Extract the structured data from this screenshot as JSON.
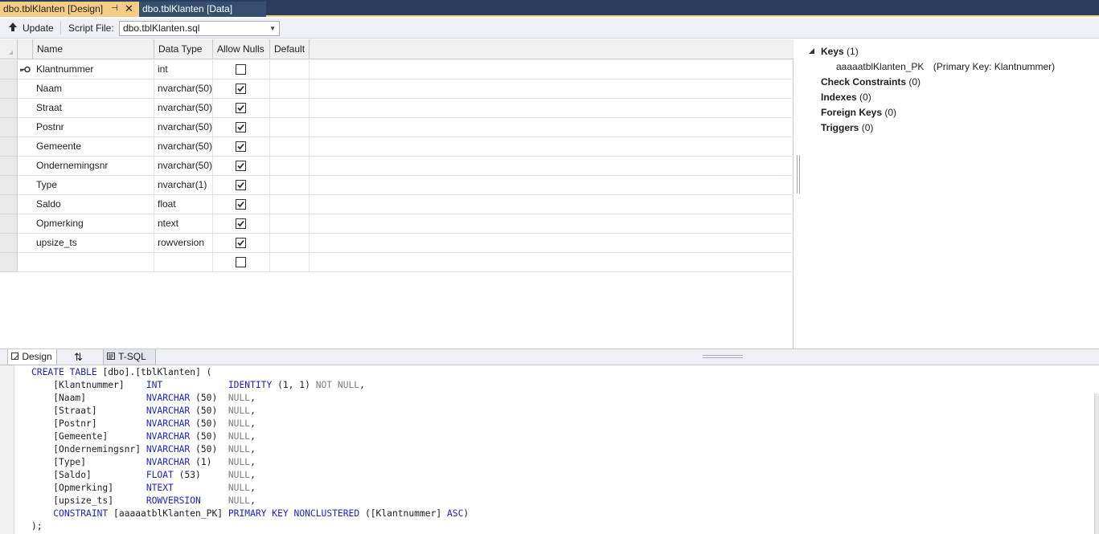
{
  "tabs": {
    "active_label": "dbo.tblKlanten [Design]",
    "inactive_label": "dbo.tblKlanten [Data]"
  },
  "toolbar": {
    "update_label": "Update",
    "script_file_label": "Script File:",
    "script_file_value": "dbo.tblKlanten.sql"
  },
  "grid": {
    "headers": [
      "Name",
      "Data Type",
      "Allow Nulls",
      "Default"
    ],
    "rows": [
      {
        "name": "Klantnummer",
        "type": "int",
        "allow_nulls": false,
        "primary_key": true
      },
      {
        "name": "Naam",
        "type": "nvarchar(50)",
        "allow_nulls": true
      },
      {
        "name": "Straat",
        "type": "nvarchar(50)",
        "allow_nulls": true
      },
      {
        "name": "Postnr",
        "type": "nvarchar(50)",
        "allow_nulls": true
      },
      {
        "name": "Gemeente",
        "type": "nvarchar(50)",
        "allow_nulls": true
      },
      {
        "name": "Ondernemingsnr",
        "type": "nvarchar(50)",
        "allow_nulls": true
      },
      {
        "name": "Type",
        "type": "nvarchar(1)",
        "allow_nulls": true
      },
      {
        "name": "Saldo",
        "type": "float",
        "allow_nulls": true
      },
      {
        "name": "Opmerking",
        "type": "ntext",
        "allow_nulls": true
      },
      {
        "name": "upsize_ts",
        "type": "rowversion",
        "allow_nulls": true
      },
      {
        "name": "",
        "type": "",
        "allow_nulls": false
      }
    ]
  },
  "properties": {
    "keys_label": "Keys",
    "keys_count": "(1)",
    "key_name": "aaaaatblKlanten_PK",
    "key_detail": "(Primary Key: Klantnummer)",
    "check_label": "Check Constraints",
    "check_count": "(0)",
    "indexes_label": "Indexes",
    "indexes_count": "(0)",
    "fk_label": "Foreign Keys",
    "fk_count": "(0)",
    "triggers_label": "Triggers",
    "triggers_count": "(0)"
  },
  "pane_tabs": {
    "design_label": "Design",
    "tsql_label": "T-SQL"
  },
  "sql": {
    "lines": [
      "CREATE TABLE [dbo].[tblKlanten] (",
      "    [Klantnummer]    INT            IDENTITY (1, 1) NOT NULL,",
      "    [Naam]           NVARCHAR (50)  NULL,",
      "    [Straat]         NVARCHAR (50)  NULL,",
      "    [Postnr]         NVARCHAR (50)  NULL,",
      "    [Gemeente]       NVARCHAR (50)  NULL,",
      "    [Ondernemingsnr] NVARCHAR (50)  NULL,",
      "    [Type]           NVARCHAR (1)   NULL,",
      "    [Saldo]          FLOAT (53)     NULL,",
      "    [Opmerking]      NTEXT          NULL,",
      "    [upsize_ts]      ROWVERSION     NULL,",
      "    CONSTRAINT [aaaaatblKlanten_PK] PRIMARY KEY NONCLUSTERED ([Klantnummer] ASC)",
      ");"
    ]
  },
  "colors": {
    "accent_tab": "#f5cc84",
    "tabbar_bg": "#2b3d5c",
    "sql_keyword": "#1d1ec9",
    "sql_gray": "#7f7f7f"
  }
}
